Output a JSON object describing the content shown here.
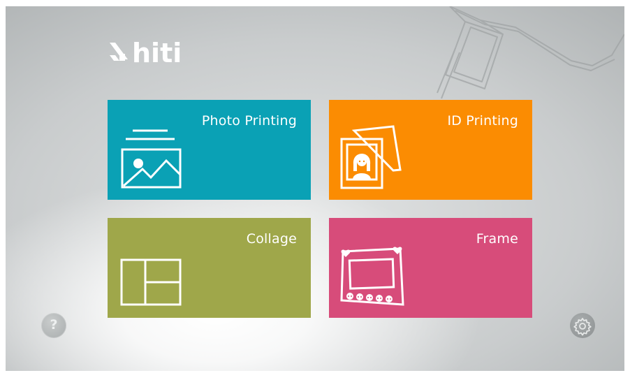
{
  "brand": {
    "logo_text": "hiti"
  },
  "tiles": [
    {
      "id": "photo-printing",
      "label": "Photo Printing",
      "color": "#0aa1b5",
      "icon": "photo-print-icon"
    },
    {
      "id": "id-printing",
      "label": "ID Printing",
      "color": "#fb8c02",
      "icon": "id-photo-icon"
    },
    {
      "id": "collage",
      "label": "Collage",
      "color": "#9fa74a",
      "icon": "collage-layout-icon"
    },
    {
      "id": "frame",
      "label": "Frame",
      "color": "#d74c7a",
      "icon": "photo-frame-icon"
    }
  ],
  "footer": {
    "help_label": "?",
    "help_icon": "help-icon",
    "settings_icon": "gear-icon"
  }
}
